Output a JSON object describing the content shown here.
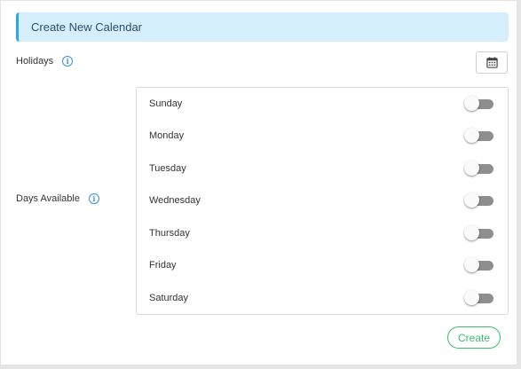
{
  "header": {
    "title": "Create New Calendar"
  },
  "holidays": {
    "label": "Holidays",
    "info_icon": "info-icon",
    "calendar_icon": "calendar-icon"
  },
  "days_available": {
    "label": "Days Available",
    "info_icon": "info-icon",
    "days": [
      {
        "name": "Sunday",
        "enabled": false
      },
      {
        "name": "Monday",
        "enabled": false
      },
      {
        "name": "Tuesday",
        "enabled": false
      },
      {
        "name": "Wednesday",
        "enabled": false
      },
      {
        "name": "Thursday",
        "enabled": false
      },
      {
        "name": "Friday",
        "enabled": false
      },
      {
        "name": "Saturday",
        "enabled": false
      }
    ]
  },
  "actions": {
    "create_label": "Create"
  },
  "colors": {
    "header_background": "#d4eefb",
    "header_accent": "#2ea8dc",
    "header_text": "#2c4f6e",
    "info_icon": "#3a8fd6",
    "create_button": "#3dbb6f",
    "toggle_off_track": "#8e8e8e"
  }
}
